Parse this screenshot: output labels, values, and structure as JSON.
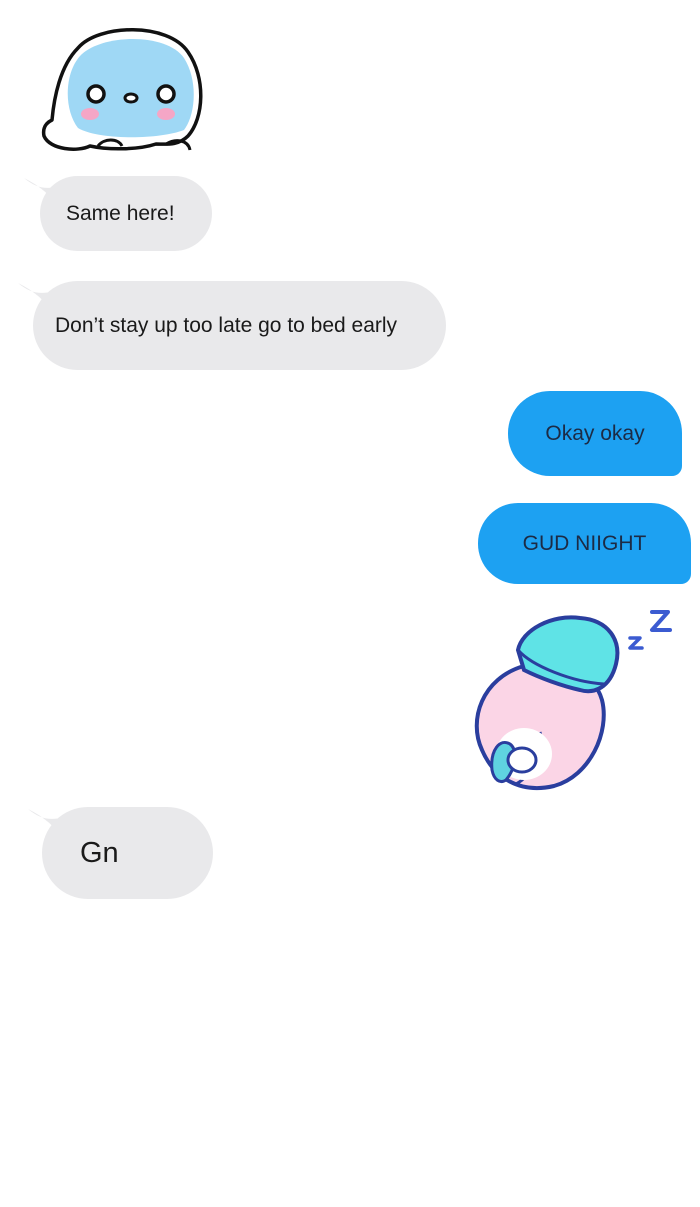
{
  "messages": [
    {
      "type": "sticker",
      "direction": "received",
      "sticker": "blue-blob-sticker"
    },
    {
      "type": "text",
      "direction": "received",
      "text": "Same here!"
    },
    {
      "type": "text",
      "direction": "received",
      "text": "Don’t stay up too late go to bed early"
    },
    {
      "type": "text",
      "direction": "sent",
      "text": "Okay okay"
    },
    {
      "type": "text",
      "direction": "sent",
      "text": "GUD NIIGHT"
    },
    {
      "type": "sticker",
      "direction": "sent",
      "sticker": "sleeping-blob-sticker"
    },
    {
      "type": "text",
      "direction": "received",
      "text": "Gn"
    }
  ],
  "colors": {
    "received_bubble": "#e9e9eb",
    "sent_bubble": "#1da1f2",
    "sent_text": "#1c2b45",
    "received_text": "#1a1a1a"
  }
}
